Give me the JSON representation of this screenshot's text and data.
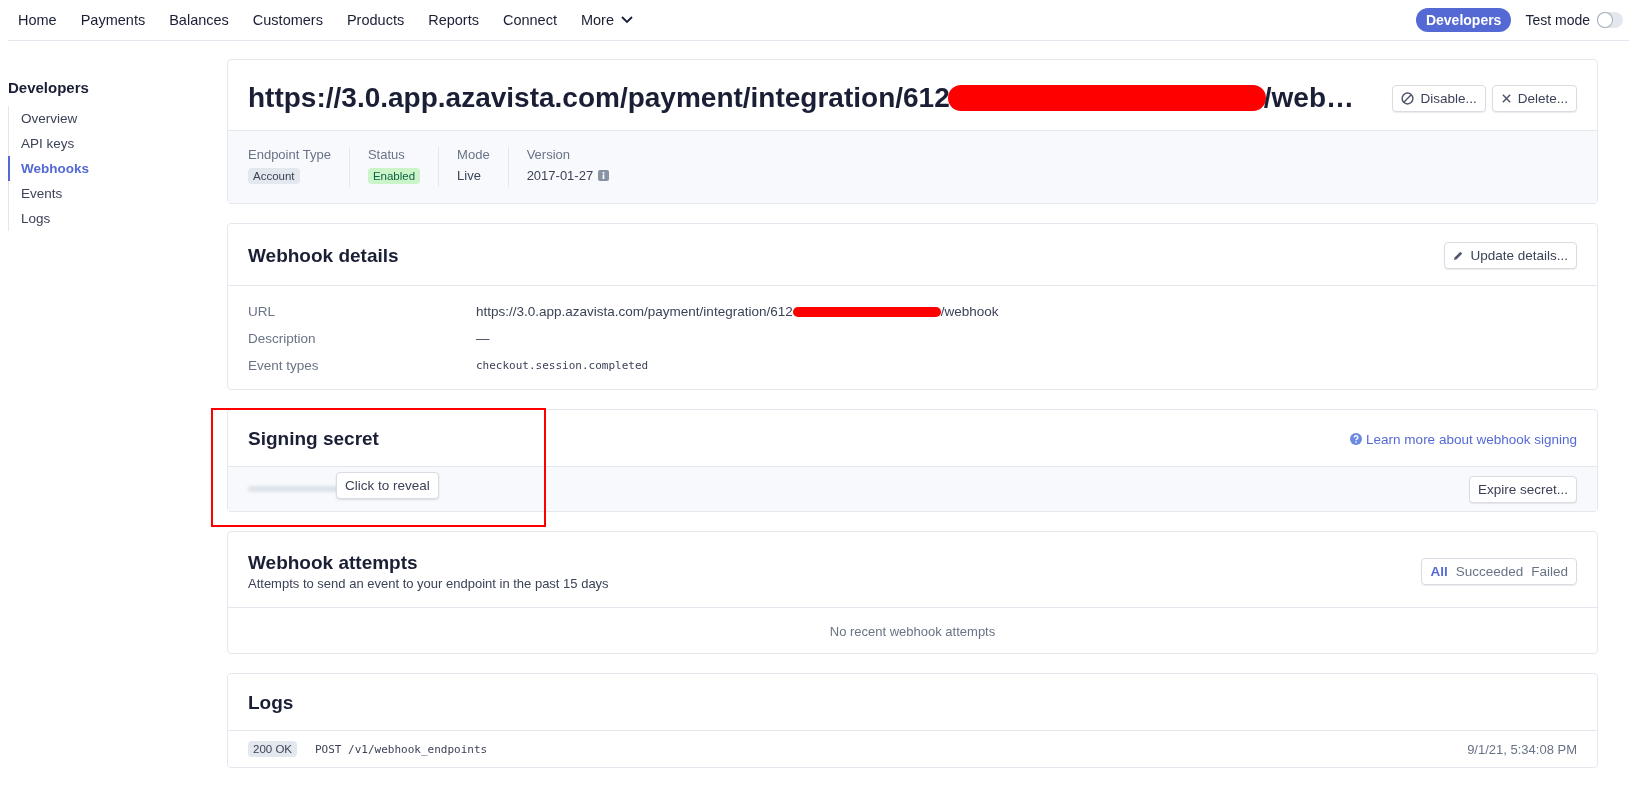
{
  "nav": {
    "items": [
      {
        "label": "Home"
      },
      {
        "label": "Payments"
      },
      {
        "label": "Balances"
      },
      {
        "label": "Customers"
      },
      {
        "label": "Products"
      },
      {
        "label": "Reports"
      },
      {
        "label": "Connect"
      },
      {
        "label": "More",
        "dropdown": true
      }
    ],
    "developers_button": "Developers",
    "test_mode": {
      "label": "Test mode",
      "on": false
    }
  },
  "sidebar": {
    "title": "Developers",
    "items": [
      {
        "label": "Overview",
        "selected": false
      },
      {
        "label": "API keys",
        "selected": false
      },
      {
        "label": "Webhooks",
        "selected": true
      },
      {
        "label": "Events",
        "selected": false
      },
      {
        "label": "Logs",
        "selected": false
      }
    ]
  },
  "endpoint": {
    "title": {
      "before": "https://3.0.app.azavista.com/payment/integration/612",
      "redacted": true,
      "after": "/web…"
    },
    "buttons": [
      {
        "label": "Disable...",
        "kind": "disable"
      },
      {
        "label": "Delete...",
        "kind": "delete"
      }
    ],
    "meta": [
      {
        "label": "Endpoint Type",
        "value": "Account",
        "kind": "tag"
      },
      {
        "label": "Status",
        "value": "Enabled",
        "kind": "status"
      },
      {
        "label": "Mode",
        "value": "Live",
        "kind": "text"
      },
      {
        "label": "Version",
        "value": "2017-01-27",
        "kind": "info"
      }
    ]
  },
  "details": {
    "title": "Webhook details",
    "button": "Update details...",
    "rows": [
      {
        "label": "URL",
        "kind": "url",
        "before": "https://3.0.app.azavista.com/payment/integration/612",
        "redacted": true,
        "after": "/webhook"
      },
      {
        "label": "Description",
        "kind": "text",
        "value": "—"
      },
      {
        "label": "Event types",
        "kind": "code",
        "value": "checkout.session.completed"
      }
    ]
  },
  "signing": {
    "title": "Signing secret",
    "link": "Learn more about webhook signing",
    "reveal": "Click to reveal",
    "button": "Expire secret...",
    "highlighted": true
  },
  "attempts": {
    "title": "Webhook attempts",
    "subtitle": "Attempts to send an event to your endpoint in the past 15 days",
    "filters": [
      {
        "label": "All",
        "selected": true
      },
      {
        "label": "Succeeded",
        "selected": false
      },
      {
        "label": "Failed",
        "selected": false
      }
    ],
    "empty": "No recent webhook attempts"
  },
  "logs": {
    "title": "Logs",
    "rows": [
      {
        "status": "200 OK",
        "request": "POST /v1/webhook_endpoints",
        "time": "9/1/21, 5:34:08 PM"
      }
    ]
  }
}
